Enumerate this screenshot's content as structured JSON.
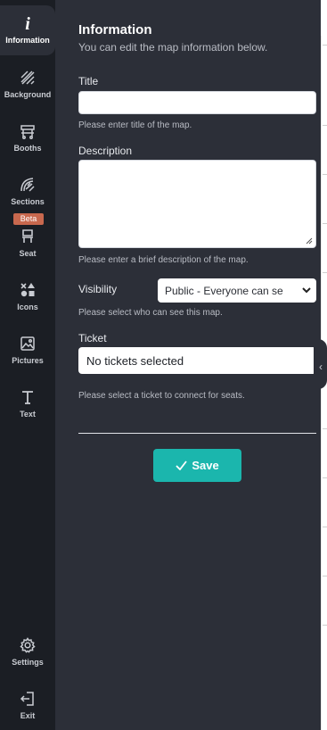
{
  "sidebar": {
    "items": [
      {
        "label": "Information",
        "icon": "info-icon"
      },
      {
        "label": "Background",
        "icon": "background-icon"
      },
      {
        "label": "Booths",
        "icon": "booth-icon"
      },
      {
        "label": "Sections",
        "icon": "sections-icon"
      },
      {
        "label": "Seat",
        "icon": "seat-icon",
        "badge": "Beta"
      },
      {
        "label": "Icons",
        "icon": "shapes-icon"
      },
      {
        "label": "Pictures",
        "icon": "picture-icon"
      },
      {
        "label": "Text",
        "icon": "text-icon"
      },
      {
        "label": "Settings",
        "icon": "gear-icon"
      },
      {
        "label": "Exit",
        "icon": "exit-icon"
      }
    ]
  },
  "panel": {
    "title": "Information",
    "subtitle": "You can edit the map information below.",
    "title_field": {
      "label": "Title",
      "value": "",
      "help": "Please enter title of the map."
    },
    "description_field": {
      "label": "Description",
      "value": "",
      "help": "Please enter a brief description of the map."
    },
    "visibility_field": {
      "label": "Visibility",
      "selected": "Public - Everyone can se",
      "help": "Please select who can see this map."
    },
    "ticket_field": {
      "label": "Ticket",
      "value": "No tickets selected",
      "help": "Please select a ticket to connect for seats."
    },
    "save_label": "Save"
  },
  "colors": {
    "rail_bg": "#1b1e24",
    "panel_bg": "#2c2f38",
    "accent": "#1bb6ad",
    "beta": "#c8684e"
  }
}
